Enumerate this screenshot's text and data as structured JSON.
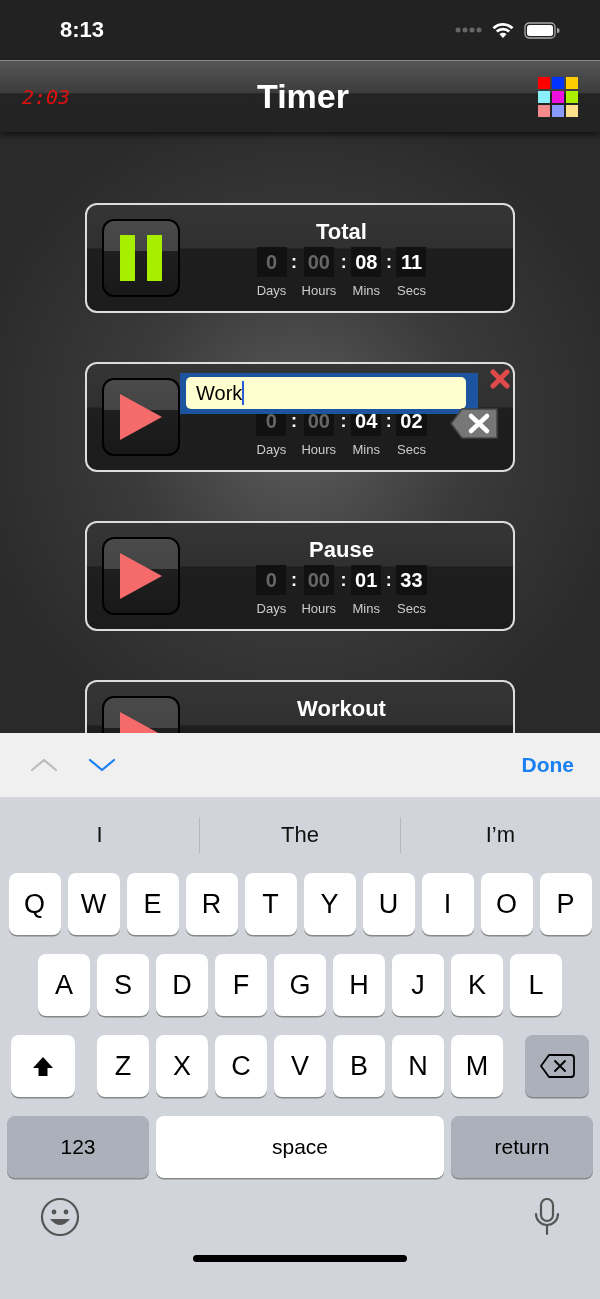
{
  "status_bar": {
    "time": "8:13"
  },
  "nav_bar": {
    "clock": "2:03",
    "title": "Timer"
  },
  "cards": [
    {
      "running": true,
      "title": "Total",
      "units": [
        {
          "value": "0",
          "label": "Days",
          "dim": true
        },
        {
          "separator": ":",
          "value": "00",
          "label": "Hours",
          "dim": true
        },
        {
          "separator": ":",
          "value": "08",
          "label": "Mins",
          "dim": false
        },
        {
          "separator": ":",
          "value": "11",
          "label": "Secs",
          "dim": false
        }
      ]
    },
    {
      "running": false,
      "name_field": {
        "value": "Work"
      },
      "units": [
        {
          "value": "0",
          "label": "Days",
          "dim": true
        },
        {
          "separator": ":",
          "value": "00",
          "label": "Hours",
          "dim": true
        },
        {
          "separator": ":",
          "value": "04",
          "label": "Mins",
          "dim": false
        },
        {
          "separator": ":",
          "value": "02",
          "label": "Secs",
          "dim": false
        }
      ]
    },
    {
      "running": false,
      "title": "Pause",
      "units": [
        {
          "value": "0",
          "label": "Days",
          "dim": true
        },
        {
          "separator": ":",
          "value": "00",
          "label": "Hours",
          "dim": true
        },
        {
          "separator": ":",
          "value": "01",
          "label": "Mins",
          "dim": false
        },
        {
          "separator": ":",
          "value": "33",
          "label": "Secs",
          "dim": false
        }
      ]
    },
    {
      "running": false,
      "title": "Workout"
    }
  ],
  "accessory_bar": {
    "previous_disabled": true,
    "next_disabled": false,
    "done": "Done"
  },
  "keyboard": {
    "suggestions": [
      "I",
      "The",
      "I’m"
    ],
    "rows": [
      [
        {
          "kind": "letter",
          "label": "Q"
        },
        {
          "kind": "letter",
          "label": "W"
        },
        {
          "kind": "letter",
          "label": "E"
        },
        {
          "kind": "letter",
          "label": "R"
        },
        {
          "kind": "letter",
          "label": "T"
        },
        {
          "kind": "letter",
          "label": "Y"
        },
        {
          "kind": "letter",
          "label": "U"
        },
        {
          "kind": "letter",
          "label": "I"
        },
        {
          "kind": "letter",
          "label": "O"
        },
        {
          "kind": "letter",
          "label": "P"
        }
      ],
      [
        {
          "kind": "letter",
          "label": "A"
        },
        {
          "kind": "letter",
          "label": "S"
        },
        {
          "kind": "letter",
          "label": "D"
        },
        {
          "kind": "letter",
          "label": "F"
        },
        {
          "kind": "letter",
          "label": "G"
        },
        {
          "kind": "letter",
          "label": "H"
        },
        {
          "kind": "letter",
          "label": "J"
        },
        {
          "kind": "letter",
          "label": "K"
        },
        {
          "kind": "letter",
          "label": "L"
        }
      ],
      [
        {
          "kind": "shift",
          "on": true
        },
        {
          "kind": "letter",
          "label": "Z"
        },
        {
          "kind": "letter",
          "label": "X"
        },
        {
          "kind": "letter",
          "label": "C"
        },
        {
          "kind": "letter",
          "label": "V"
        },
        {
          "kind": "letter",
          "label": "B"
        },
        {
          "kind": "letter",
          "label": "N"
        },
        {
          "kind": "letter",
          "label": "M"
        },
        {
          "kind": "delete"
        }
      ]
    ],
    "bottom_keys": [
      {
        "kind": "numbers",
        "label": "123"
      },
      {
        "kind": "space",
        "label": "space"
      },
      {
        "kind": "return",
        "label": "return"
      }
    ]
  }
}
